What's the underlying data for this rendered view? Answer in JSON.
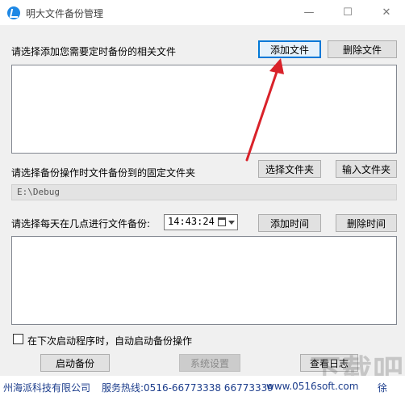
{
  "window": {
    "title": "明大文件备份管理",
    "minimize_glyph": "—",
    "maximize_glyph": "☐",
    "close_glyph": "✕"
  },
  "files_section": {
    "label": "请选择添加您需要定时备份的相关文件",
    "add_label": "添加文件",
    "delete_label": "删除文件"
  },
  "folder_section": {
    "label": "请选择备份操作时文件备份到的固定文件夹",
    "select_label": "选择文件夹",
    "input_label": "输入文件夹",
    "path": "E:\\Debug"
  },
  "time_section": {
    "label": "请选择每天在几点进行文件备份:",
    "time_value": "14:43:24",
    "add_label": "添加时间",
    "delete_label": "删除时间"
  },
  "startup": {
    "label": "在下次启动程序时，自动启动备份操作",
    "checked": false
  },
  "actions": {
    "start_label": "启动备份",
    "settings_label": "系统设置",
    "log_label": "查看日志"
  },
  "footer": {
    "company": "州海派科技有限公司",
    "hotline": "服务热线:0516-66773338 66773339",
    "website": "www.0516soft.com",
    "suffix": "徐"
  },
  "watermark": {
    "text": "下载吧"
  },
  "icons": {
    "app": "app-logo-icon",
    "calendar": "calendar-icon",
    "dropdown": "chevron-down-icon",
    "arrow": "red-arrow-annotation"
  },
  "colors": {
    "focus_border": "#0078d7",
    "annotation": "#d9222a",
    "footer_text": "#1c3d8c"
  }
}
